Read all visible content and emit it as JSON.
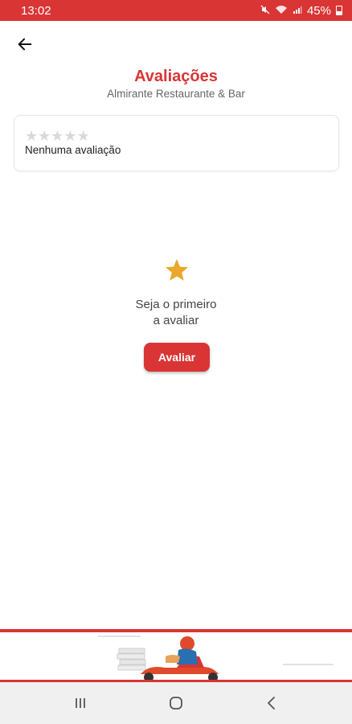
{
  "status": {
    "time": "13:02",
    "battery": "45%",
    "icons": [
      "mute-icon",
      "wifi-icon",
      "signal-icon",
      "battery-icon"
    ]
  },
  "header": {
    "back_icon": "arrow-left-icon",
    "title": "Avaliações",
    "subtitle": "Almirante Restaurante & Bar"
  },
  "rating_card": {
    "stars_filled": 0,
    "stars_total": 5,
    "label": "Nenhuma avaliação"
  },
  "empty_state": {
    "icon": "star-icon",
    "line1": "Seja o primeiro",
    "line2": "a avaliar",
    "button_label": "Avaliar"
  },
  "nav": {
    "recent_icon": "recent-apps-icon",
    "home_icon": "home-icon",
    "back_icon": "back-chevron-icon"
  },
  "colors": {
    "brand_red": "#d93535",
    "star_gold": "#e9a82b",
    "star_empty": "#d9d9d9"
  }
}
